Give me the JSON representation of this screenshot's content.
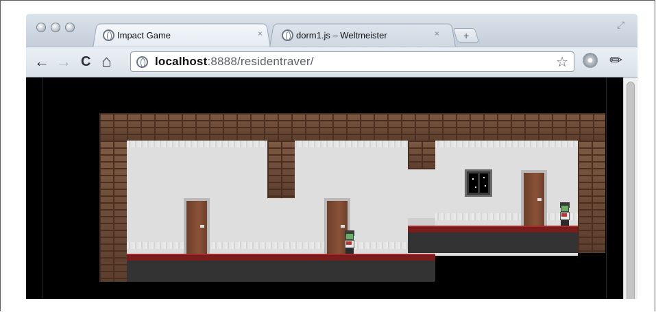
{
  "browser": {
    "tabs": [
      {
        "label": "Impact Game",
        "active": true
      },
      {
        "label": "dorm1.js – Weltmeister",
        "active": false
      }
    ],
    "close_glyph": "×",
    "new_tab_glyph": "+",
    "address": {
      "host": "localhost",
      "rest": ":8888/residentraver/"
    },
    "nav_glyphs": {
      "back": "←",
      "forward": "→",
      "reload": "C",
      "home": "⌂",
      "star": "☆",
      "wrench": "🔧"
    }
  },
  "game": {
    "scene": "dorm1",
    "colors": {
      "brick": "#6b4a36",
      "wall": "#dedede",
      "carpet": "#7a1c1c",
      "floor": "#333333",
      "door": "#8a5337"
    },
    "entities": [
      {
        "type": "player-character",
        "icon": "green-haired-character"
      },
      {
        "type": "npc-character",
        "icon": "green-haired-character"
      }
    ]
  }
}
